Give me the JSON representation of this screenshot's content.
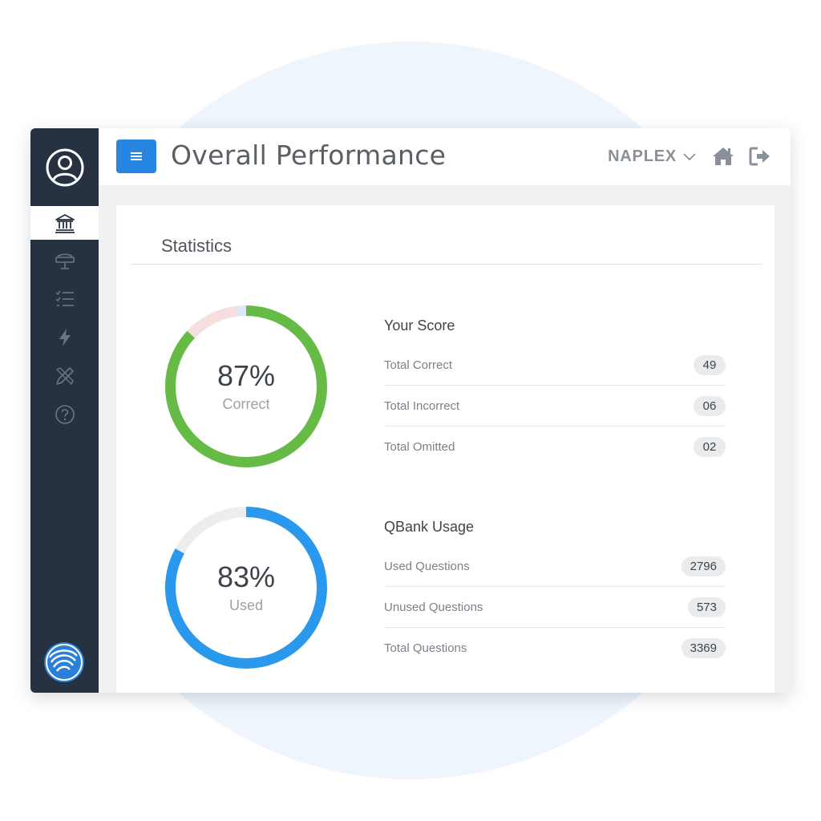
{
  "header": {
    "title": "Overall Performance",
    "exam": "NAPLEX"
  },
  "sidebar": {
    "items": [
      {
        "icon": "profile-icon"
      },
      {
        "icon": "bank-icon",
        "active": true
      },
      {
        "icon": "tutor-board-icon"
      },
      {
        "icon": "checklist-icon"
      },
      {
        "icon": "flash-icon"
      },
      {
        "icon": "pencil-ruler-icon"
      },
      {
        "icon": "help-icon"
      }
    ],
    "logo": "brand-logo-icon"
  },
  "statistics": {
    "title": "Statistics",
    "score": {
      "percent_text": "87%",
      "label": "Correct",
      "correct_fraction": 0.87,
      "incorrect_fraction": 0.11,
      "omitted_fraction": 0.02,
      "colors": {
        "correct": "#66bb46",
        "incorrect": "#f6dede",
        "omitted": "#dde9f5"
      },
      "title": "Your Score",
      "rows": [
        {
          "label": "Total Correct",
          "value": "49"
        },
        {
          "label": "Total Incorrect",
          "value": "06"
        },
        {
          "label": "Total Omitted",
          "value": "02"
        }
      ]
    },
    "usage": {
      "percent_text": "83%",
      "label": "Used",
      "used_fraction": 0.83,
      "colors": {
        "used": "#2a98ec",
        "unused": "#ededed"
      },
      "title": "QBank Usage",
      "rows": [
        {
          "label": "Used Questions",
          "value": "2796"
        },
        {
          "label": "Unused Questions",
          "value": "573"
        },
        {
          "label": "Total Questions",
          "value": "3369"
        }
      ]
    }
  },
  "colors": {
    "sidebar": "#263241",
    "accent": "#2786e2"
  }
}
